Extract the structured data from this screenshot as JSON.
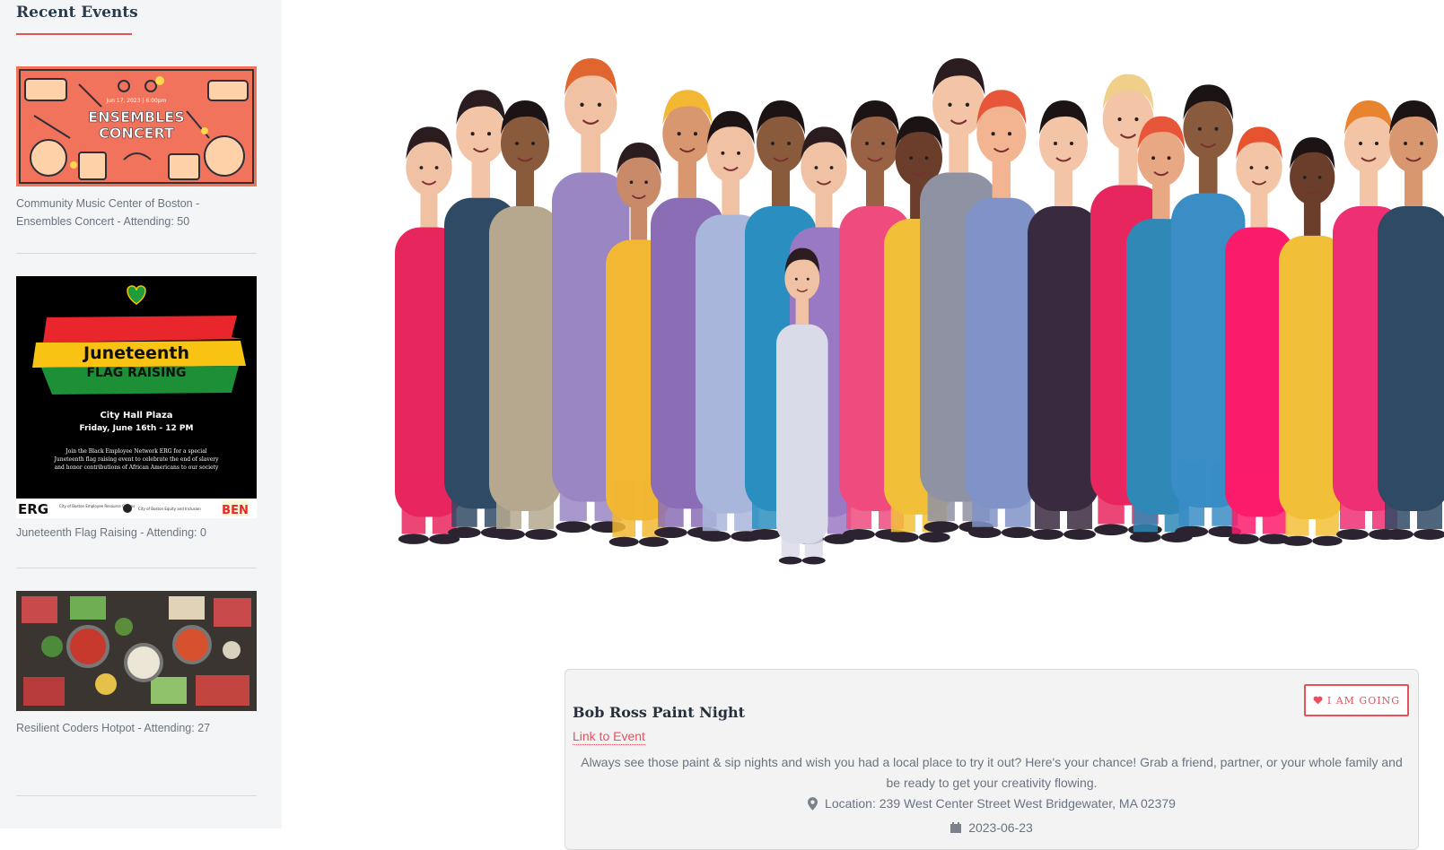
{
  "sidebar": {
    "title": "Recent Events",
    "events": [
      {
        "caption": "Community Music Center of Boston - Ensembles Concert - Attending: 50",
        "thumb": {
          "date_line": "Jun 17, 2023 | 6:00pm",
          "line1": "ENSEMBLES",
          "line2": "CONCERT"
        }
      },
      {
        "caption": "Juneteenth Flag Raising - Attending: 0",
        "thumb": {
          "line1": "Juneteenth",
          "line2": "FLAG RAISING",
          "place": "City Hall Plaza",
          "when": "Friday, June 16th - 12 PM",
          "blurb1": "Join the Black Employee Network ERG for a special",
          "blurb2": "Juneteenth flag raising event to celebrate the end of slavery",
          "blurb3": "and honor contributions of African Americans to our society",
          "footer_left": "ERG",
          "footer_left_sub": "City of Boston Employee Resource Groups",
          "footer_mid": "City of Boston Equity and Inclusion",
          "footer_right": "BEN"
        }
      },
      {
        "caption": "Resilient Coders Hotpot - Attending: 27"
      }
    ]
  },
  "event": {
    "going_label": "I AM GOING",
    "title": "Bob Ross Paint Night",
    "link_label": "Link to Event",
    "description": "Always see those paint & sip nights and wish you had a local place to try it out? Here's your chance! Grab a friend, partner, or your whole family and be ready to get your creativity flowing.",
    "location": "Location: 239 West Center Street West Bridgewater, MA 02379",
    "date": "2023-06-23"
  },
  "colors": {
    "accent": "#e8505b",
    "sidebar_bg": "#f4f5f7",
    "muted_text": "#6b7380"
  },
  "icons": {
    "going": "heart-icon",
    "location": "map-marker-icon",
    "date": "calendar-icon"
  }
}
